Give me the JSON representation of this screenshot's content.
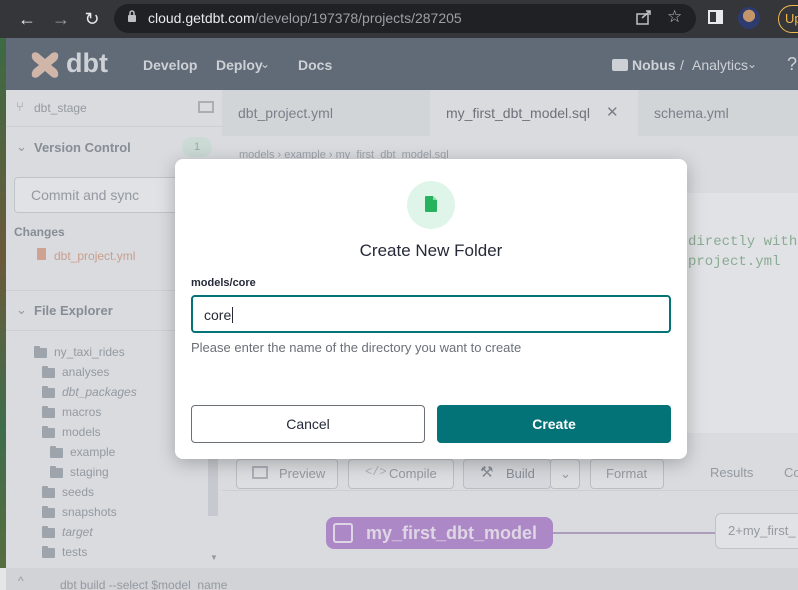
{
  "browser": {
    "url_host": "cloud.getdbt.com",
    "url_path": "/develop/197378/projects/287205",
    "update_label": "Upd"
  },
  "nav": {
    "logo_text": "dbt",
    "links": [
      "Develop",
      "Deploy",
      "Docs"
    ],
    "account": "Nobus",
    "separator": "/",
    "project": "Analytics"
  },
  "sidebar": {
    "branch": "dbt_stage",
    "version_control": "Version Control",
    "vc_count": "1",
    "commit_button": "Commit and sync",
    "changes_label": "Changes",
    "changed_file": "dbt_project.yml",
    "file_explorer": "File Explorer",
    "tree": [
      {
        "name": "ny_taxi_rides",
        "italic": false
      },
      {
        "name": "analyses",
        "italic": false
      },
      {
        "name": "dbt_packages",
        "italic": true
      },
      {
        "name": "macros",
        "italic": false
      },
      {
        "name": "models",
        "italic": false
      },
      {
        "name": "example",
        "italic": false
      },
      {
        "name": "staging",
        "italic": false
      },
      {
        "name": "seeds",
        "italic": false
      },
      {
        "name": "snapshots",
        "italic": false
      },
      {
        "name": "target",
        "italic": true
      },
      {
        "name": "tests",
        "italic": false
      }
    ]
  },
  "tabs": [
    "dbt_project.yml",
    "my_first_dbt_model.sql",
    "schema.yml"
  ],
  "editor": {
    "breadcrumb": [
      "models",
      "example",
      "my_first_dbt_model.sql"
    ],
    "code_line1": "directly within",
    "code_line2": "project.yml"
  },
  "toolbar": {
    "preview": "Preview",
    "compile": "Compile",
    "build": "Build",
    "format": "Format",
    "results": "Results",
    "compiled": "Co"
  },
  "lineage": {
    "model_node": "my_first_dbt_model",
    "select_node": "2+my_first_"
  },
  "bottom": {
    "command": "dbt build --select $model_name"
  },
  "modal": {
    "title": "Create New Folder",
    "path_label": "models/core",
    "input_value": "core",
    "help_text": "Please enter the name of the directory you want to create",
    "cancel": "Cancel",
    "create": "Create"
  },
  "colors": {
    "accent": "#047377",
    "nav_bg": "#616b77",
    "model_node": "#b98ad3"
  }
}
